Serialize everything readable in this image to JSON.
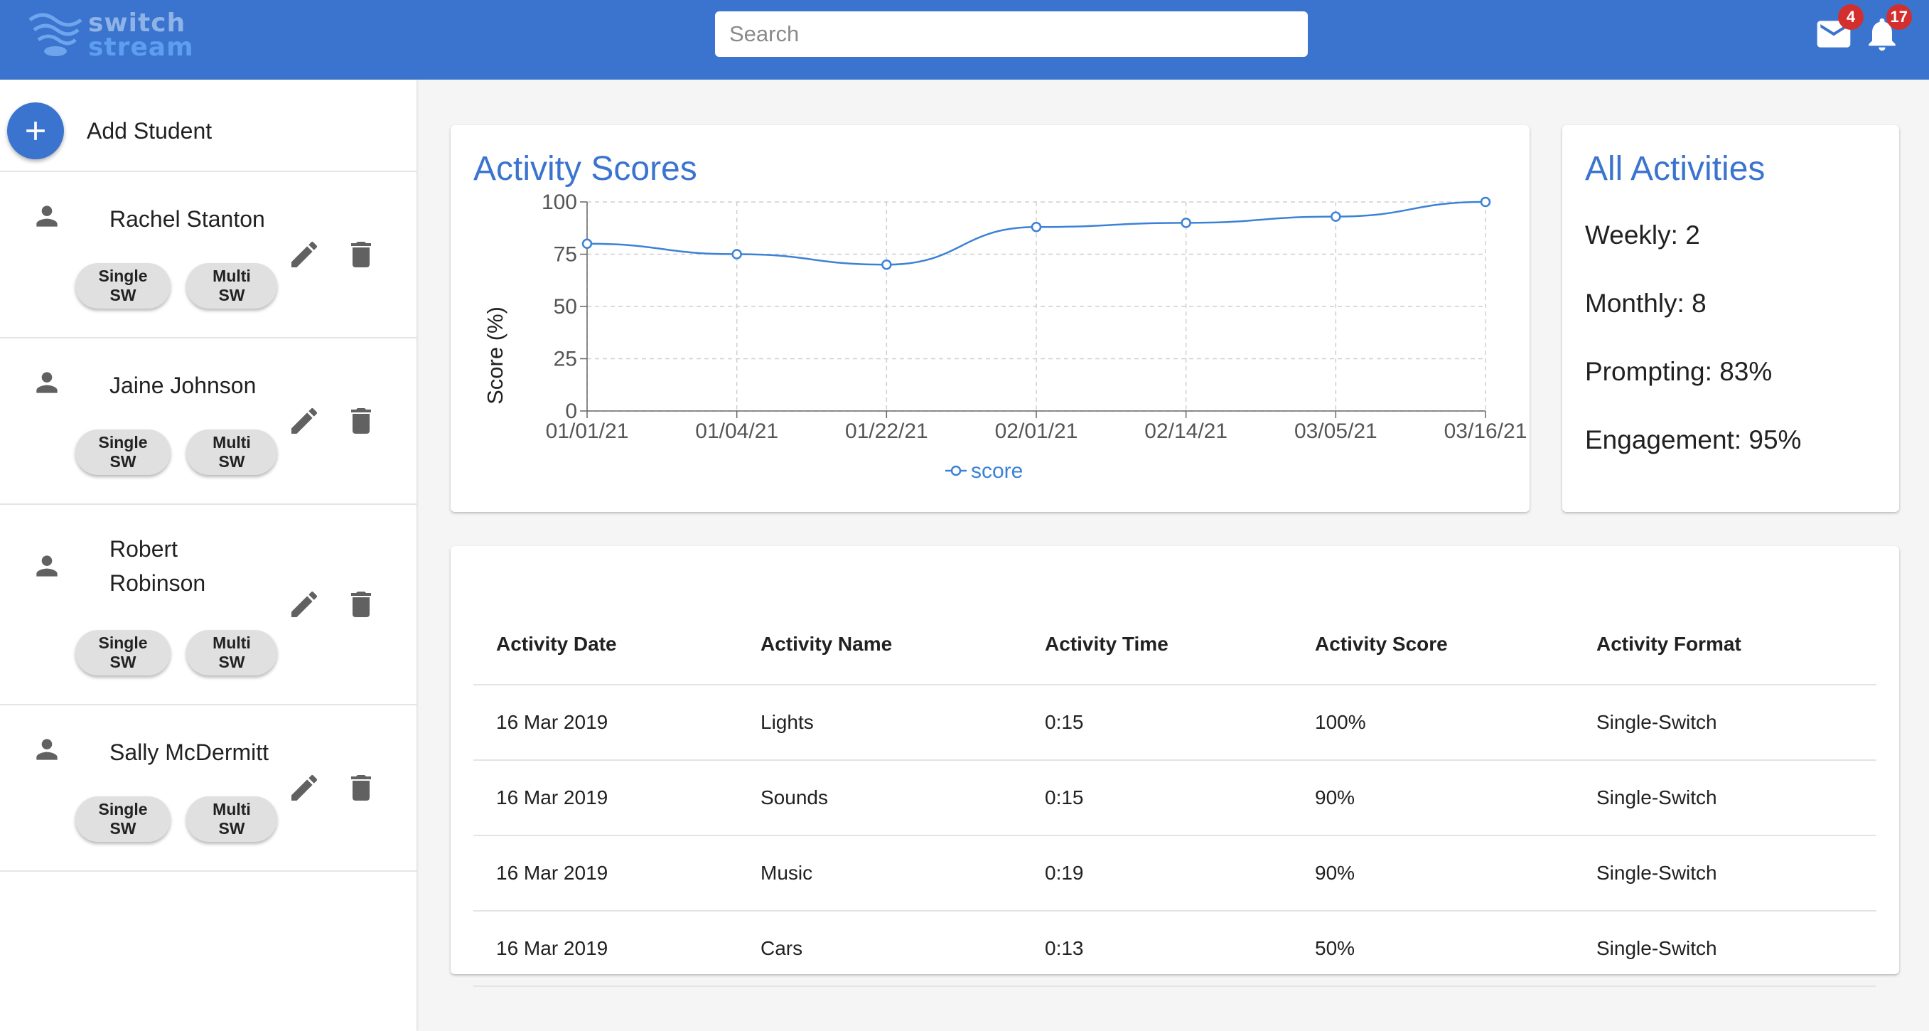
{
  "app": {
    "logo_line1": "switch",
    "logo_line2": "stream"
  },
  "header": {
    "search_placeholder": "Search",
    "mail_count": "4",
    "notification_count": "17"
  },
  "sidebar": {
    "add_label": "Add Student",
    "students": [
      {
        "name": "Rachel Stanton",
        "chip_single": "Single SW",
        "chip_multi": "Multi SW"
      },
      {
        "name": "Jaine Johnson",
        "chip_single": "Single SW",
        "chip_multi": "Multi SW"
      },
      {
        "name": "Robert Robinson",
        "chip_single": "Single SW",
        "chip_multi": "Multi SW"
      },
      {
        "name": "Sally McDermitt",
        "chip_single": "Single SW",
        "chip_multi": "Multi SW"
      }
    ]
  },
  "scores_card": {
    "title": "Activity Scores"
  },
  "chart_data": {
    "type": "line",
    "title": "Activity Scores",
    "xlabel": "",
    "ylabel": "Score (%)",
    "categories": [
      "01/01/21",
      "01/04/21",
      "01/22/21",
      "02/01/21",
      "02/14/21",
      "03/05/21",
      "03/16/21"
    ],
    "series": [
      {
        "name": "score",
        "values": [
          80,
          75,
          70,
          88,
          90,
          93,
          100
        ],
        "color": "#3b82d6"
      }
    ],
    "yticks": [
      "0",
      "25",
      "50",
      "75",
      "100"
    ],
    "ylim": [
      0,
      100
    ],
    "grid": true,
    "legend": "bottom"
  },
  "activities_card": {
    "title": "All Activities",
    "weekly": "Weekly: 2",
    "monthly": "Monthly: 8",
    "prompting": "Prompting: 83%",
    "engagement": "Engagement: 95%"
  },
  "table": {
    "headers": [
      "Activity Date",
      "Activity Name",
      "Activity Time",
      "Activity Score",
      "Activity Format"
    ],
    "rows": [
      [
        "16 Mar 2019",
        "Lights",
        "0:15",
        "100%",
        "Single-Switch"
      ],
      [
        "16 Mar 2019",
        "Sounds",
        "0:15",
        "90%",
        "Single-Switch"
      ],
      [
        "16 Mar 2019",
        "Music",
        "0:19",
        "90%",
        "Single-Switch"
      ],
      [
        "16 Mar 2019",
        "Cars",
        "0:13",
        "50%",
        "Single-Switch"
      ]
    ]
  },
  "colors": {
    "primary": "#3b74ce",
    "accent": "#3b82d6",
    "badge": "#d32f2f"
  },
  "icons": [
    "waves-logo-icon",
    "mail-icon",
    "bell-icon",
    "plus-icon",
    "person-icon",
    "pencil-icon",
    "trash-icon"
  ]
}
